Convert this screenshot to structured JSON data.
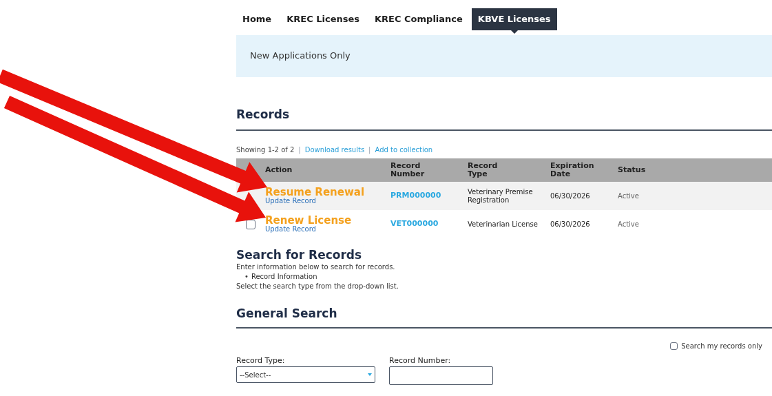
{
  "tabs": [
    {
      "label": "Home",
      "selected": false
    },
    {
      "label": "KREC Licenses",
      "selected": false
    },
    {
      "label": "KREC Compliance",
      "selected": false
    },
    {
      "label": "KBVE Licenses",
      "selected": true
    }
  ],
  "banner": "New Applications Only",
  "records": {
    "title": "Records",
    "showing": "Showing 1-2 of 2",
    "separator": "|",
    "links": [
      "Download results",
      "Add to collection"
    ],
    "columns": [
      "Action",
      "Record Number",
      "Record Type",
      "Expiration Date",
      "Status"
    ],
    "rows": [
      {
        "action": "Resume Renewal",
        "sub_action": "Update Record",
        "record_number": "PRM000000",
        "record_type": "Veterinary Premise Registration",
        "expiration": "06/30/2026",
        "status": "Active"
      },
      {
        "checked": false,
        "action": "Renew License",
        "sub_action": "Update Record",
        "record_number": "VET000000",
        "record_type": "Veterinarian License",
        "expiration": "06/30/2026",
        "status": "Active"
      }
    ]
  },
  "search": {
    "title": "Search for Records",
    "intro": "Enter information below to search for records.",
    "bullet": "•",
    "bullets": [
      "Record Information"
    ],
    "hint": "Select the search type from the drop-down list."
  },
  "general_search": {
    "title": "General Search",
    "my_records": {
      "label": "Search my records only",
      "checked": false
    },
    "fields": [
      {
        "kind": "select",
        "label": "Record Type:",
        "value": "--Select--"
      },
      {
        "kind": "text",
        "label": "Record Number:"
      }
    ]
  },
  "annotations": [
    {
      "kind": "arrow"
    },
    {
      "kind": "arrow"
    }
  ]
}
